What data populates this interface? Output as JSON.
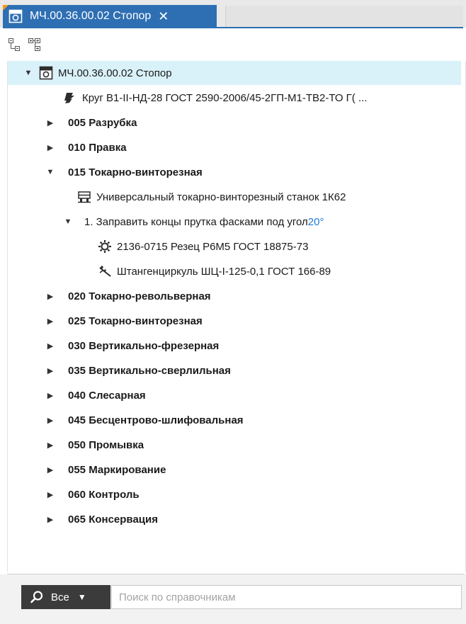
{
  "tab": {
    "title": "МЧ.00.36.00.02 Стопор",
    "close": "✕"
  },
  "toolbar": {
    "collapse_icon": "collapse-all-icon",
    "expand_icon": "expand-all-icon"
  },
  "tree": {
    "root": "МЧ.00.36.00.02 Стопор",
    "material": "Круг В1-II-НД-28 ГОСТ 2590-2006/45-2ГП-М1-ТВ2-ТО Г( ...",
    "operations": [
      "005 Разрубка",
      "010 Правка",
      "015 Токарно-винторезная",
      "020 Токарно-револьверная",
      "025 Токарно-винторезная",
      "030 Вертикально-фрезерная",
      "035 Вертикально-сверлильная",
      "040 Слесарная",
      "045 Бесцентрово-шлифовальная",
      "050 Промывка",
      "055 Маркирование",
      "060 Контроль",
      "065 Консервация"
    ],
    "machine": "Универсальный токарно-винторезный станок 1К62",
    "step": {
      "text": "1. Заправить концы прутка фасками под угол ",
      "angle": "20°"
    },
    "tool": "2136-0715 Резец Р6М5 ГОСТ 18875-73",
    "gauge": "Штангенциркуль ШЦ-I-125-0,1 ГОСТ 166-89"
  },
  "search": {
    "scope": "Все",
    "placeholder": "Поиск по справочникам"
  },
  "colors": {
    "tab": "#2e6fb4",
    "tab_corner": "#f39a1d",
    "selected_row": "#d9f1f8",
    "angle": "#1d7ad6",
    "scope_button": "#3b3b3b"
  }
}
